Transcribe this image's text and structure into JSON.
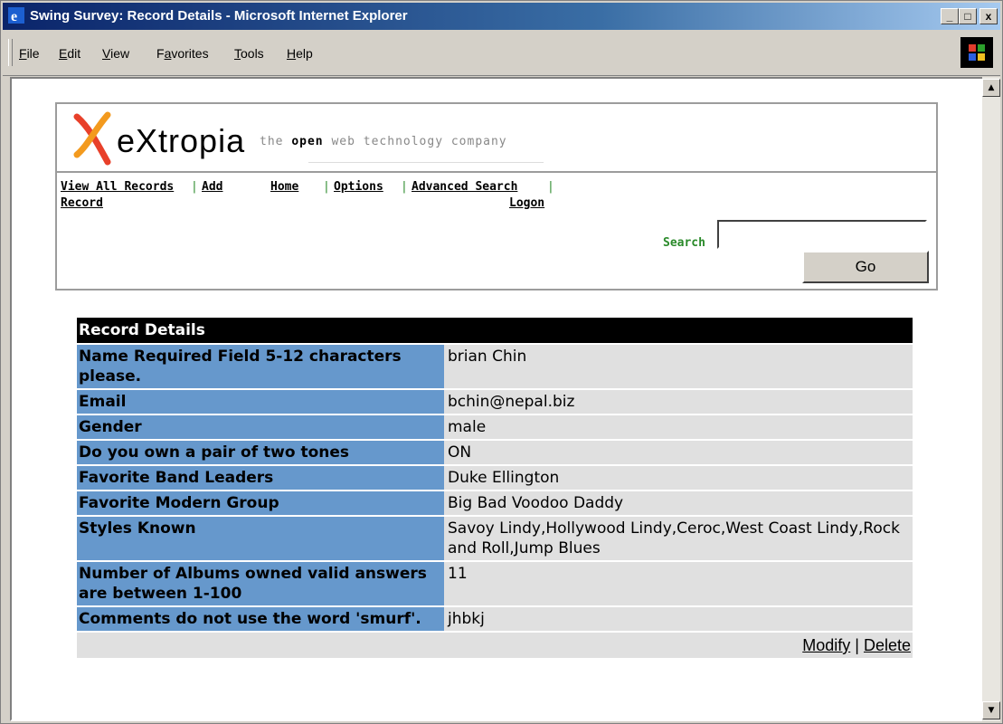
{
  "window": {
    "title": "Swing Survey: Record Details - Microsoft Internet Explorer",
    "buttons": {
      "minimize": "_",
      "maximize": "□",
      "close": "x"
    }
  },
  "menu": {
    "items": [
      {
        "label": "File",
        "accel": "F",
        "rest": "ile"
      },
      {
        "label": "Edit",
        "accel": "E",
        "rest": "dit"
      },
      {
        "label": "View",
        "accel": "V",
        "rest": "iew"
      },
      {
        "label": "Favorites",
        "pre": "F",
        "accel": "a",
        "rest": "vorites"
      },
      {
        "label": "Tools",
        "accel": "T",
        "rest": "ools"
      },
      {
        "label": "Help",
        "accel": "H",
        "rest": "elp"
      }
    ]
  },
  "header": {
    "logo_text": "eXtropia",
    "tagline_pre": "the ",
    "tagline_bold": "open",
    "tagline_post": " web technology company",
    "nav": {
      "view_all": "View All Records",
      "sep": "|",
      "add": "Add",
      "add_cont": "Record",
      "home": "Home",
      "options": "Options",
      "advanced": "Advanced Search",
      "logon": "Logon"
    },
    "search_label": "Search",
    "search_value": "",
    "go_label": "Go"
  },
  "record": {
    "heading": "Record Details",
    "rows": [
      {
        "label": "Name Required Field 5-12 characters please.",
        "value": "brian Chin"
      },
      {
        "label": "Email",
        "value": "bchin@nepal.biz"
      },
      {
        "label": "Gender",
        "value": "male"
      },
      {
        "label": "Do you own a pair of two tones",
        "value": "ON"
      },
      {
        "label": "Favorite Band Leaders",
        "value": "Duke Ellington"
      },
      {
        "label": "Favorite Modern Group",
        "value": "Big Bad Voodoo Daddy"
      },
      {
        "label": "Styles Known",
        "value": "Savoy Lindy,Hollywood Lindy,Ceroc,West Coast Lindy,Rock and Roll,Jump Blues"
      },
      {
        "label": "Number of Albums owned valid answers are between 1-100",
        "value": "11"
      },
      {
        "label": "Comments do not use the word 'smurf'.",
        "value": "jhbkj"
      }
    ],
    "modify_label": "Modify",
    "action_sep": "|",
    "delete_label": "Delete"
  },
  "colors": {
    "label_bg": "#6698cc",
    "value_bg": "#e0e0e0",
    "header_bg": "#000000",
    "separator_green": "#2a8a2a"
  }
}
